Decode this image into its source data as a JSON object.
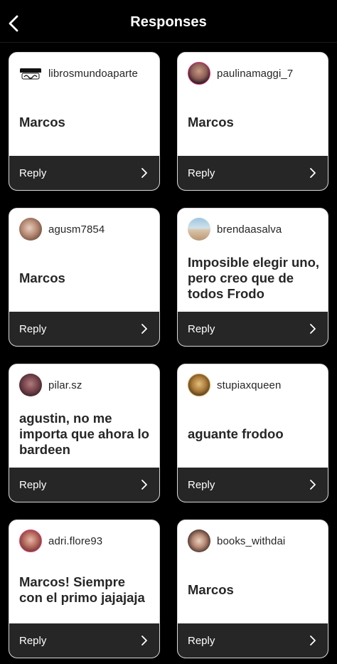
{
  "header": {
    "title": "Responses",
    "back_icon": "chevron-left-icon"
  },
  "colors": {
    "background": "#000000",
    "card": "#ffffff",
    "reply_bar": "#262626",
    "text_dark": "#262626",
    "text_light": "#ffffff"
  },
  "responses": [
    {
      "username": "librosmundoaparte",
      "text": "Marcos",
      "reply_label": "Reply",
      "avatar_logo_text": "MUNDO Aparte"
    },
    {
      "username": "paulinamaggi_7",
      "text": "Marcos",
      "reply_label": "Reply"
    },
    {
      "username": "agusm7854",
      "text": "Marcos",
      "reply_label": "Reply"
    },
    {
      "username": "brendaasalva",
      "text": "Imposible elegir uno, pero creo que de todos Frodo",
      "reply_label": "Reply"
    },
    {
      "username": "pilar.sz",
      "text": "agustin, no me importa que ahora lo bardeen",
      "reply_label": "Reply"
    },
    {
      "username": "stupiaxqueen",
      "text": "aguante frodoo",
      "reply_label": "Reply"
    },
    {
      "username": "adri.flore93",
      "text": "Marcos! Siempre con el primo jajajaja",
      "reply_label": "Reply"
    },
    {
      "username": "books_withdai",
      "text": "Marcos",
      "reply_label": "Reply"
    }
  ]
}
